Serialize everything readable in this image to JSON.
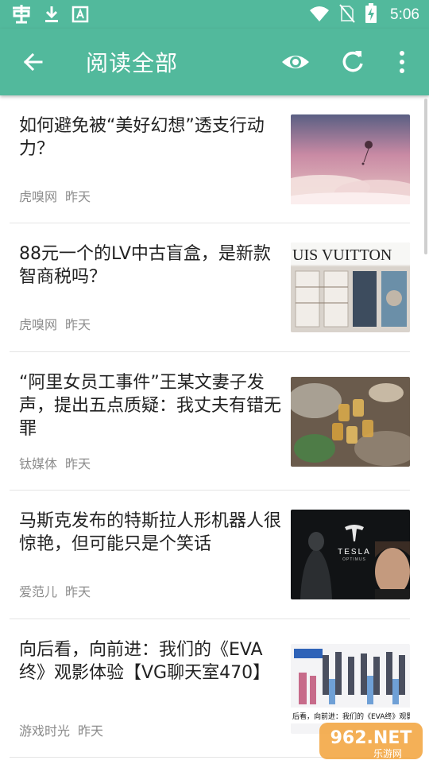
{
  "status_bar": {
    "time": "5:06",
    "icons": [
      "app-logo-icon",
      "download-icon",
      "app-store-icon",
      "wifi-icon",
      "no-sim-icon",
      "battery-charging-icon"
    ]
  },
  "app_bar": {
    "title": "阅读全部",
    "icons": [
      "back-arrow-icon",
      "eye-icon",
      "refresh-icon",
      "more-vert-icon"
    ]
  },
  "articles": [
    {
      "title": "如何避免被“美好幻想”透支行动力？",
      "source": "虎嗅网",
      "time": "昨天",
      "image": "sky-clouds-balloon"
    },
    {
      "title": "88元一个的LV中古盲盒，是新款智商税吗？",
      "source": "虎嗅网",
      "time": "昨天",
      "image": "louis-vuitton-store",
      "image_text": "UIS VUITTON"
    },
    {
      "title": "“阿里女员工事件”王某文妻子发声，提出五点质疑：我丈夫有错无罪",
      "source": "钛媒体",
      "time": "昨天",
      "image": "dinner-toast"
    },
    {
      "title": "马斯克发布的特斯拉人形机器人很惊艳，但可能只是个笑话",
      "source": "爱范儿",
      "time": "昨天",
      "image": "tesla-optimus",
      "image_text": "TESLA",
      "image_subtext": "OPTIMUS"
    },
    {
      "title": "向后看，向前进：我们的《EVA 终》观影体验【VG聊天室470】",
      "source": "游戏时光",
      "time": "昨天",
      "image": "eva-poster",
      "image_text": "后看，向前进：我们的《EVA终》观影体"
    }
  ],
  "watermark": {
    "brand": "962.NET",
    "sub": "乐游网"
  },
  "colors": {
    "primary": "#52b99c",
    "title_text": "#222222",
    "meta_text": "#8c8c8c",
    "divider": "#e4e4e4"
  }
}
